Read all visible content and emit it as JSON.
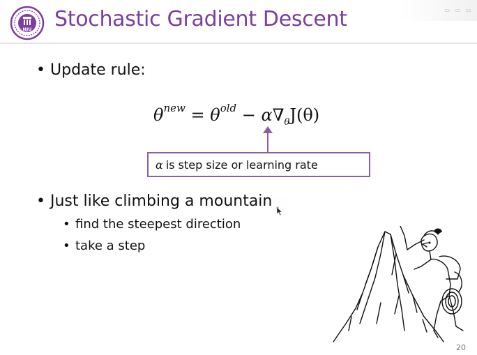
{
  "slide": {
    "title": "Stochastic Gradient Descent",
    "page_number": "20",
    "logo_text": "NJU",
    "corner_text": "▭ ▭ ▭"
  },
  "bullets": [
    {
      "text": "Update rule:"
    },
    {
      "text": "Just like climbing a mountain",
      "sub": [
        "find the steepest direction",
        "take a step"
      ]
    }
  ],
  "formula": {
    "lhs": "θ",
    "lhs_sup": "new",
    "eq": "=",
    "rhs_theta": "θ",
    "rhs_sup": "old",
    "minus": "−",
    "alpha": "α",
    "nabla": "∇",
    "nabla_sub": "θ",
    "J": "J(θ)"
  },
  "callout": {
    "symbol": "α",
    "text": "is step size or learning rate"
  },
  "colors": {
    "accent": "#7b3fa0",
    "box": "#8b5fa8",
    "text": "#111111"
  },
  "icons": [
    "university-logo-icon",
    "mountain-climber-illustration",
    "mouse-cursor-icon"
  ]
}
